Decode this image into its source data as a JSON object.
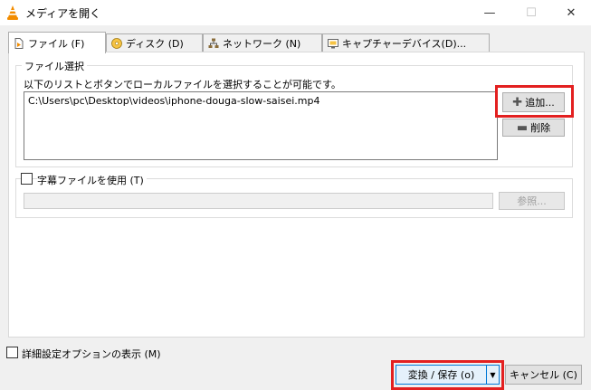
{
  "window": {
    "title": "メディアを開く",
    "minimize_glyph": "—",
    "maximize_glyph": "☐",
    "close_glyph": "✕"
  },
  "tabs": [
    {
      "label": "ファイル (F)",
      "icon": "file-icon",
      "active": true
    },
    {
      "label": "ディスク (D)",
      "icon": "disc-icon",
      "active": false
    },
    {
      "label": "ネットワーク (N)",
      "icon": "network-icon",
      "active": false
    },
    {
      "label": "キャプチャーデバイス(D)...",
      "icon": "capture-device-icon",
      "active": false
    }
  ],
  "file_selection": {
    "group_label": "ファイル選択",
    "description": "以下のリストとボタンでローカルファイルを選択することが可能です。",
    "files": [
      "C:\\Users\\pc\\Desktop\\videos\\iphone-douga-slow-saisei.mp4"
    ],
    "add_label": "追加...",
    "add_icon": "plus-icon",
    "remove_label": "削除",
    "remove_icon": "minus-icon"
  },
  "subtitle": {
    "checkbox_label": "字幕ファイルを使用 (T)",
    "checked": false,
    "path_value": "",
    "browse_label": "参照..."
  },
  "advanced": {
    "checkbox_label": "詳細設定オプションの表示 (M)",
    "checked": false
  },
  "footer": {
    "convert_label": "変換 / 保存 (o)",
    "cancel_label": "キャンセル (C)"
  },
  "highlight_color": "#e32020"
}
